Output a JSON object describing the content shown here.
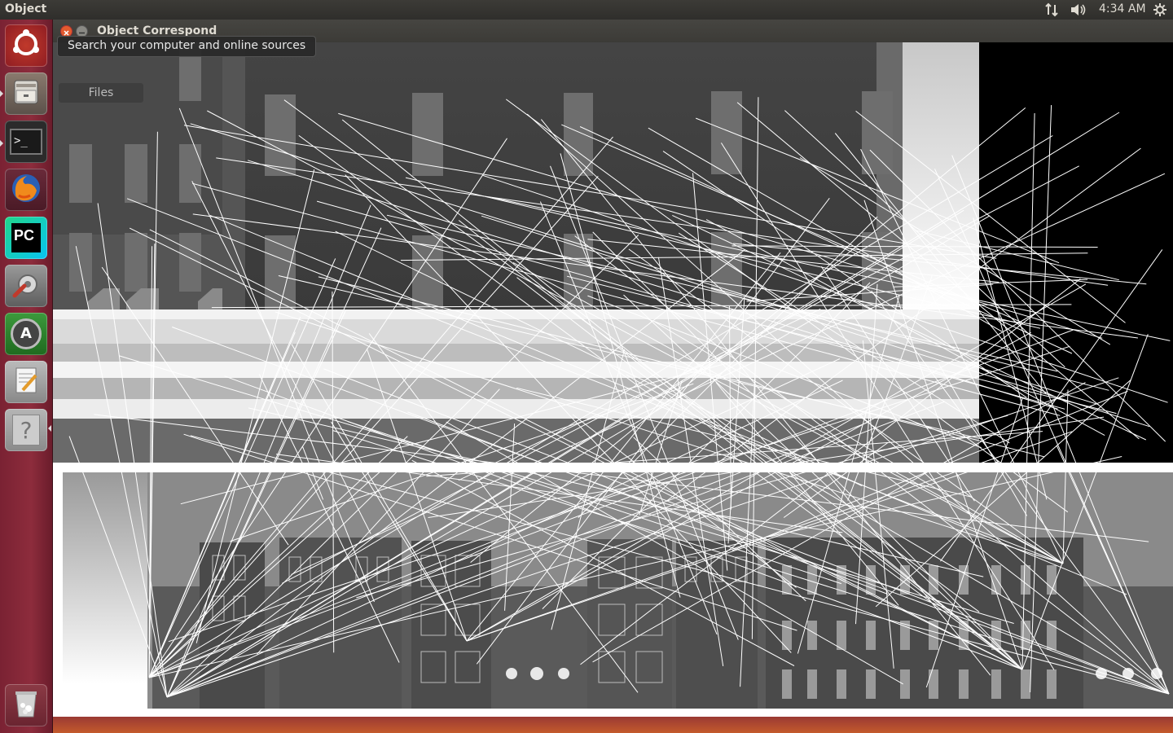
{
  "top_panel": {
    "app_title": "Object",
    "clock": "4:34 AM",
    "network_icon": "network-updown-icon",
    "volume_icon": "volume-icon",
    "settings_icon": "gear-icon"
  },
  "window": {
    "title": "Object Correspond",
    "tooltip": "Search your computer and online sources",
    "hover_label": "Files"
  },
  "launcher": {
    "items": [
      {
        "name": "dash-home",
        "icon": "ubuntu-logo-icon"
      },
      {
        "name": "files",
        "icon": "file-cabinet-icon"
      },
      {
        "name": "terminal",
        "icon": "terminal-icon",
        "glyph": ">_"
      },
      {
        "name": "firefox",
        "icon": "firefox-icon"
      },
      {
        "name": "pycharm",
        "icon": "pycharm-icon",
        "glyph": "PC"
      },
      {
        "name": "system-settings",
        "icon": "wrench-gear-icon"
      },
      {
        "name": "software-updater",
        "icon": "software-updater-icon",
        "glyph": "A"
      },
      {
        "name": "text-editor",
        "icon": "text-editor-icon"
      },
      {
        "name": "help",
        "icon": "help-icon",
        "glyph": "?"
      },
      {
        "name": "trash",
        "icon": "trash-icon"
      }
    ]
  },
  "colors": {
    "launcher": "#8d2c3c",
    "panel": "#3c3b37",
    "close": "#e25a2e"
  }
}
